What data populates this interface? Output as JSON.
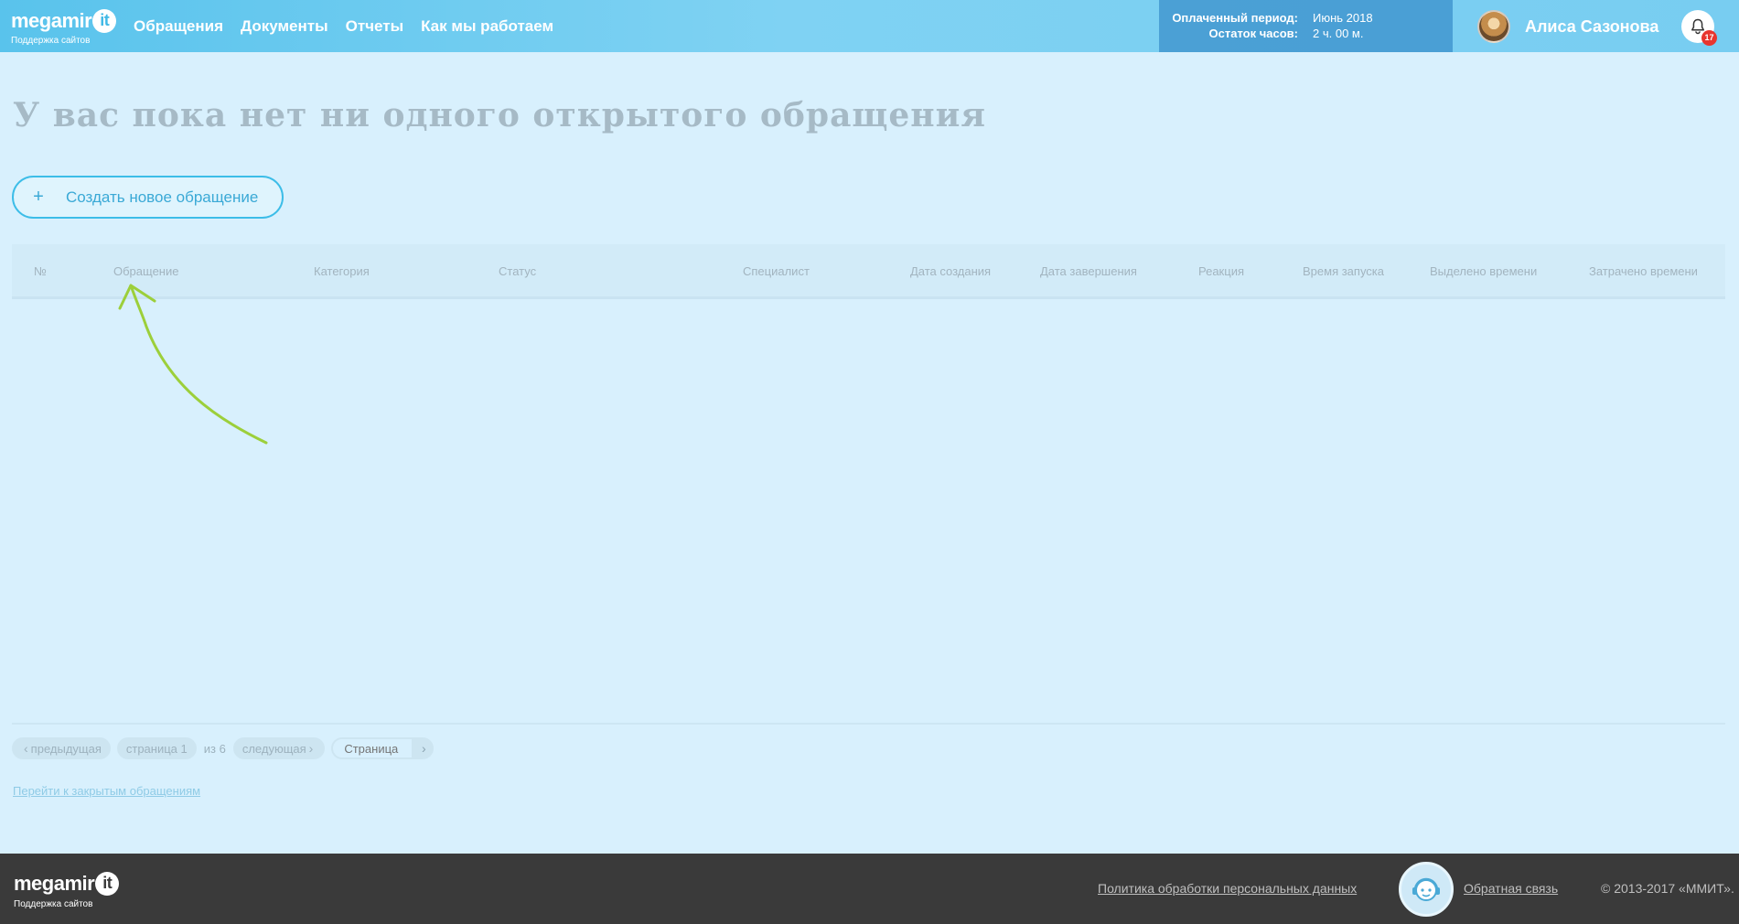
{
  "header": {
    "logo_word": "megamir",
    "logo_badge": "it",
    "logo_tagline": "Поддержка сайтов",
    "nav": [
      {
        "label": "Обращения"
      },
      {
        "label": "Документы"
      },
      {
        "label": "Отчеты"
      },
      {
        "label": "Как мы работаем"
      }
    ],
    "period_label": "Оплаченный период:",
    "period_value": "Июнь 2018",
    "hours_label": "Остаток часов:",
    "hours_value": "2 ч. 00 м.",
    "user_name": "Алиса Сазонова",
    "notifications_count": "17"
  },
  "main": {
    "title": "У вас пока нет ни одного открытого обращения",
    "create_button": {
      "icon": "+",
      "label": "Создать новое обращение"
    },
    "table_columns": [
      "№",
      "Обращение",
      "Категория",
      "Статус",
      "Специалист",
      "Дата создания",
      "Дата завершения",
      "Реакция",
      "Время запуска",
      "Выделено времени",
      "Затрачено времени"
    ],
    "pagination": {
      "prev_label": "предыдущая",
      "page_label": "страница 1",
      "of_label": "из 6",
      "next_label": "следующая",
      "page_input_placeholder": "Страница"
    },
    "closed_link": "Перейти к закрытым обращениям"
  },
  "footer": {
    "logo_word": "megamir",
    "logo_badge": "it",
    "logo_tagline": "Поддержка сайтов",
    "policy_link": "Политика обработки персональных данных",
    "feedback_link": "Обратная связь",
    "copyright": "© 2013-2017 «ММИТ»."
  },
  "colors": {
    "header_gradient_start": "#59c3ec",
    "accent": "#3cbde8",
    "badge_red": "#e8352e",
    "footer_bg": "#3a3a3a",
    "arrow_green": "#9ccf3a"
  }
}
